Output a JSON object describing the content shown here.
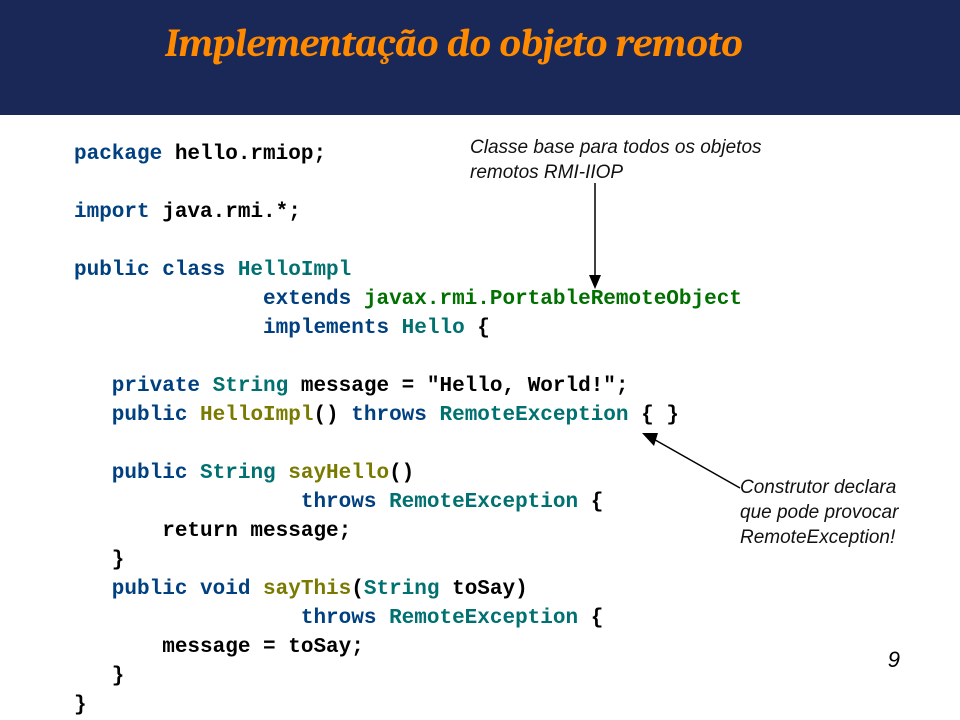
{
  "header": {
    "title": "Implementação do objeto remoto"
  },
  "callouts": {
    "top_line1": "Classe base para todos os objetos",
    "top_line2": "remotos RMI-IIOP",
    "right_line1": "Construtor declara",
    "right_line2": "que pode provocar",
    "right_line3": "RemoteException!"
  },
  "code": {
    "l1a": "package",
    "l1b": " hello.rmiop;",
    "l2a": "import",
    "l2b": " java.rmi.*;",
    "l3a": "public class ",
    "l3b": "HelloImpl",
    "l4a": "               extends ",
    "l4b": "javax.rmi.PortableRemoteObject",
    "l5a": "               implements ",
    "l5b": "Hello",
    "l5c": " {",
    "l6a": "   private ",
    "l6b": "String",
    "l6c": " message = \"Hello, World!\";",
    "l7a": "   public ",
    "l7b": "HelloImpl",
    "l7c": "() ",
    "l7d": "throws ",
    "l7e": "RemoteException",
    "l7f": " { }",
    "l8a": "   public ",
    "l8b": "String ",
    "l8c": "sayHello",
    "l8d": "()",
    "l9a": "                  throws ",
    "l9b": "RemoteException",
    "l9c": " {",
    "l10": "       return message;",
    "l11": "   }",
    "l12a": "   public void ",
    "l12b": "sayThis",
    "l12c": "(",
    "l12d": "String",
    "l12e": " toSay)",
    "l13a": "                  throws ",
    "l13b": "RemoteException",
    "l13c": " {",
    "l14": "       message = toSay;",
    "l15": "   }",
    "l16": "}"
  },
  "page_number": "9"
}
